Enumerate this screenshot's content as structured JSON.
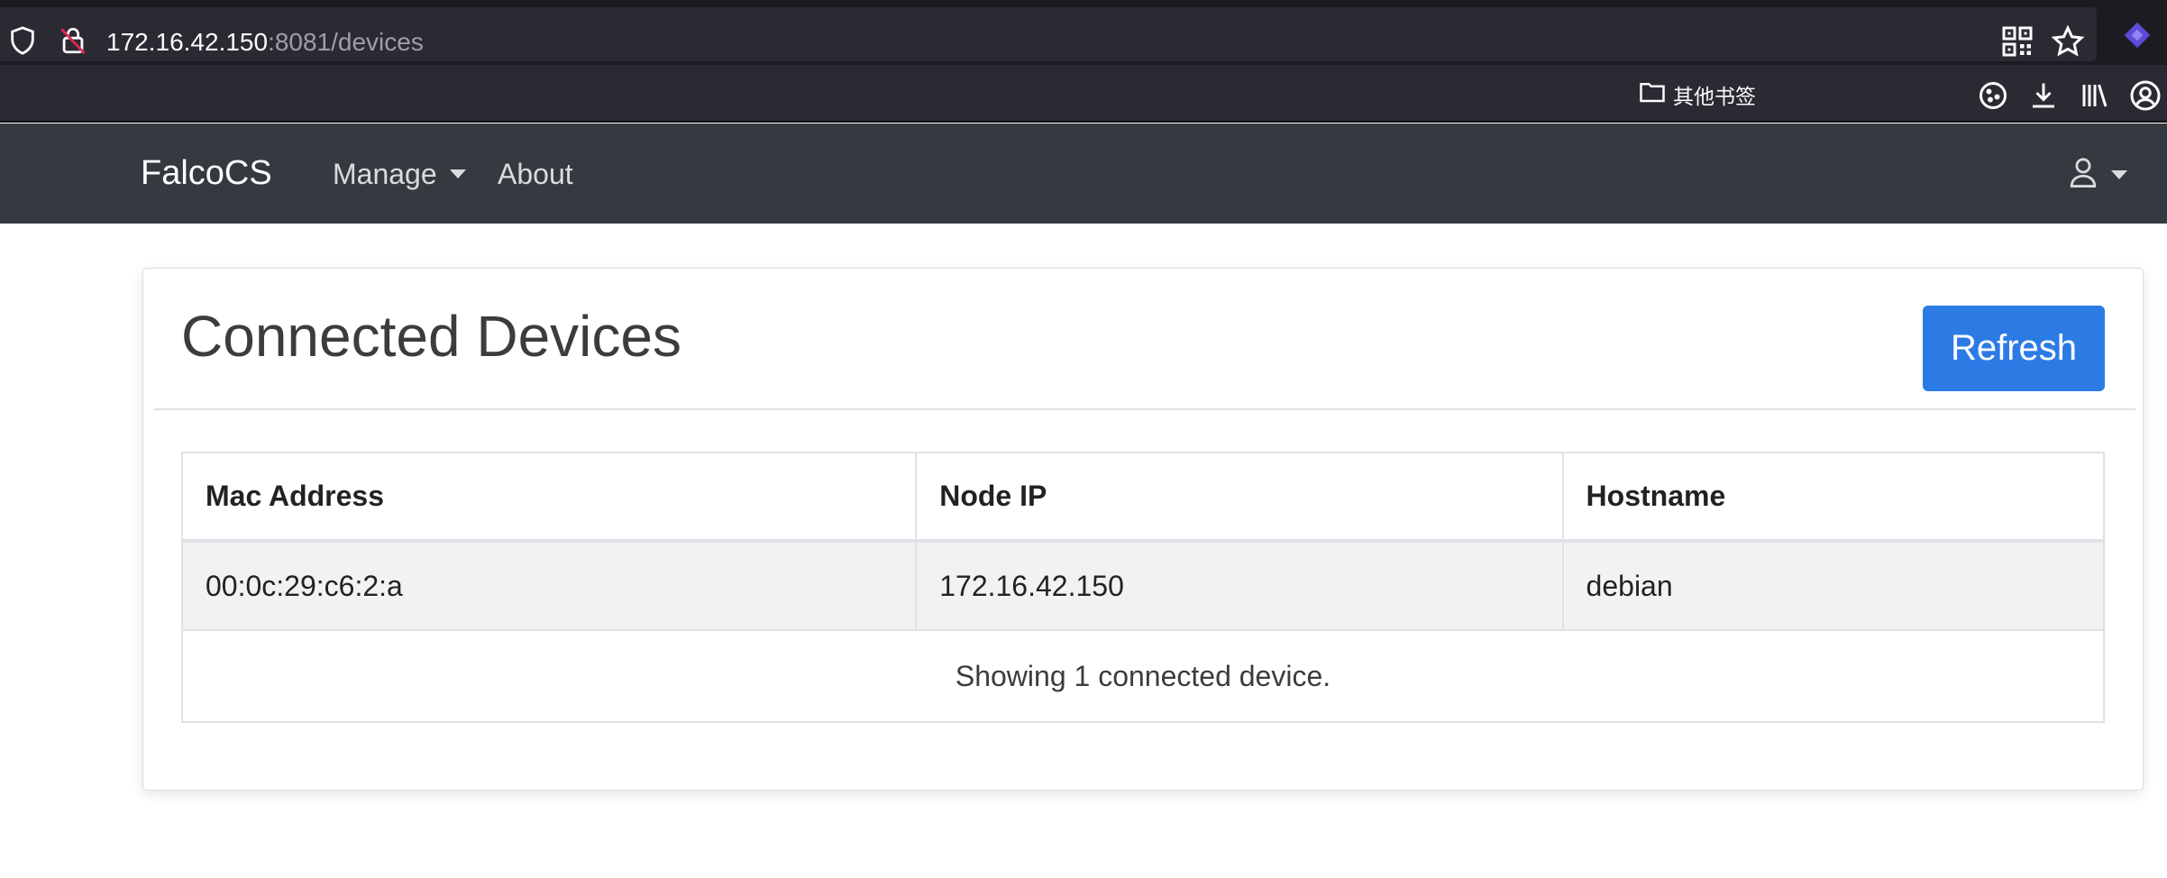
{
  "browser": {
    "url_host": "172.16.42.150",
    "url_path": ":8081/devices",
    "bookmark_folder": "其他书签"
  },
  "navbar": {
    "brand": "FalcoCS",
    "manage_label": "Manage",
    "about_label": "About"
  },
  "card": {
    "title": "Connected Devices",
    "refresh_label": "Refresh",
    "table": {
      "headers": [
        "Mac Address",
        "Node IP",
        "Hostname"
      ],
      "rows": [
        [
          "00:0c:29:c6:2:a",
          "172.16.42.150",
          "debian"
        ]
      ],
      "footer": "Showing 1 connected device."
    }
  },
  "colors": {
    "navbar_bg": "#343a40",
    "primary_button": "#2c7be5",
    "browser_bg": "#2b2a33"
  },
  "icons": [
    "shield-icon",
    "insecure-lock-icon",
    "qr-code-icon",
    "bookmark-star-icon",
    "extension-icon",
    "folder-icon",
    "cookie-icon",
    "download-icon",
    "library-icon",
    "account-icon",
    "user-icon",
    "chevron-down-icon"
  ]
}
